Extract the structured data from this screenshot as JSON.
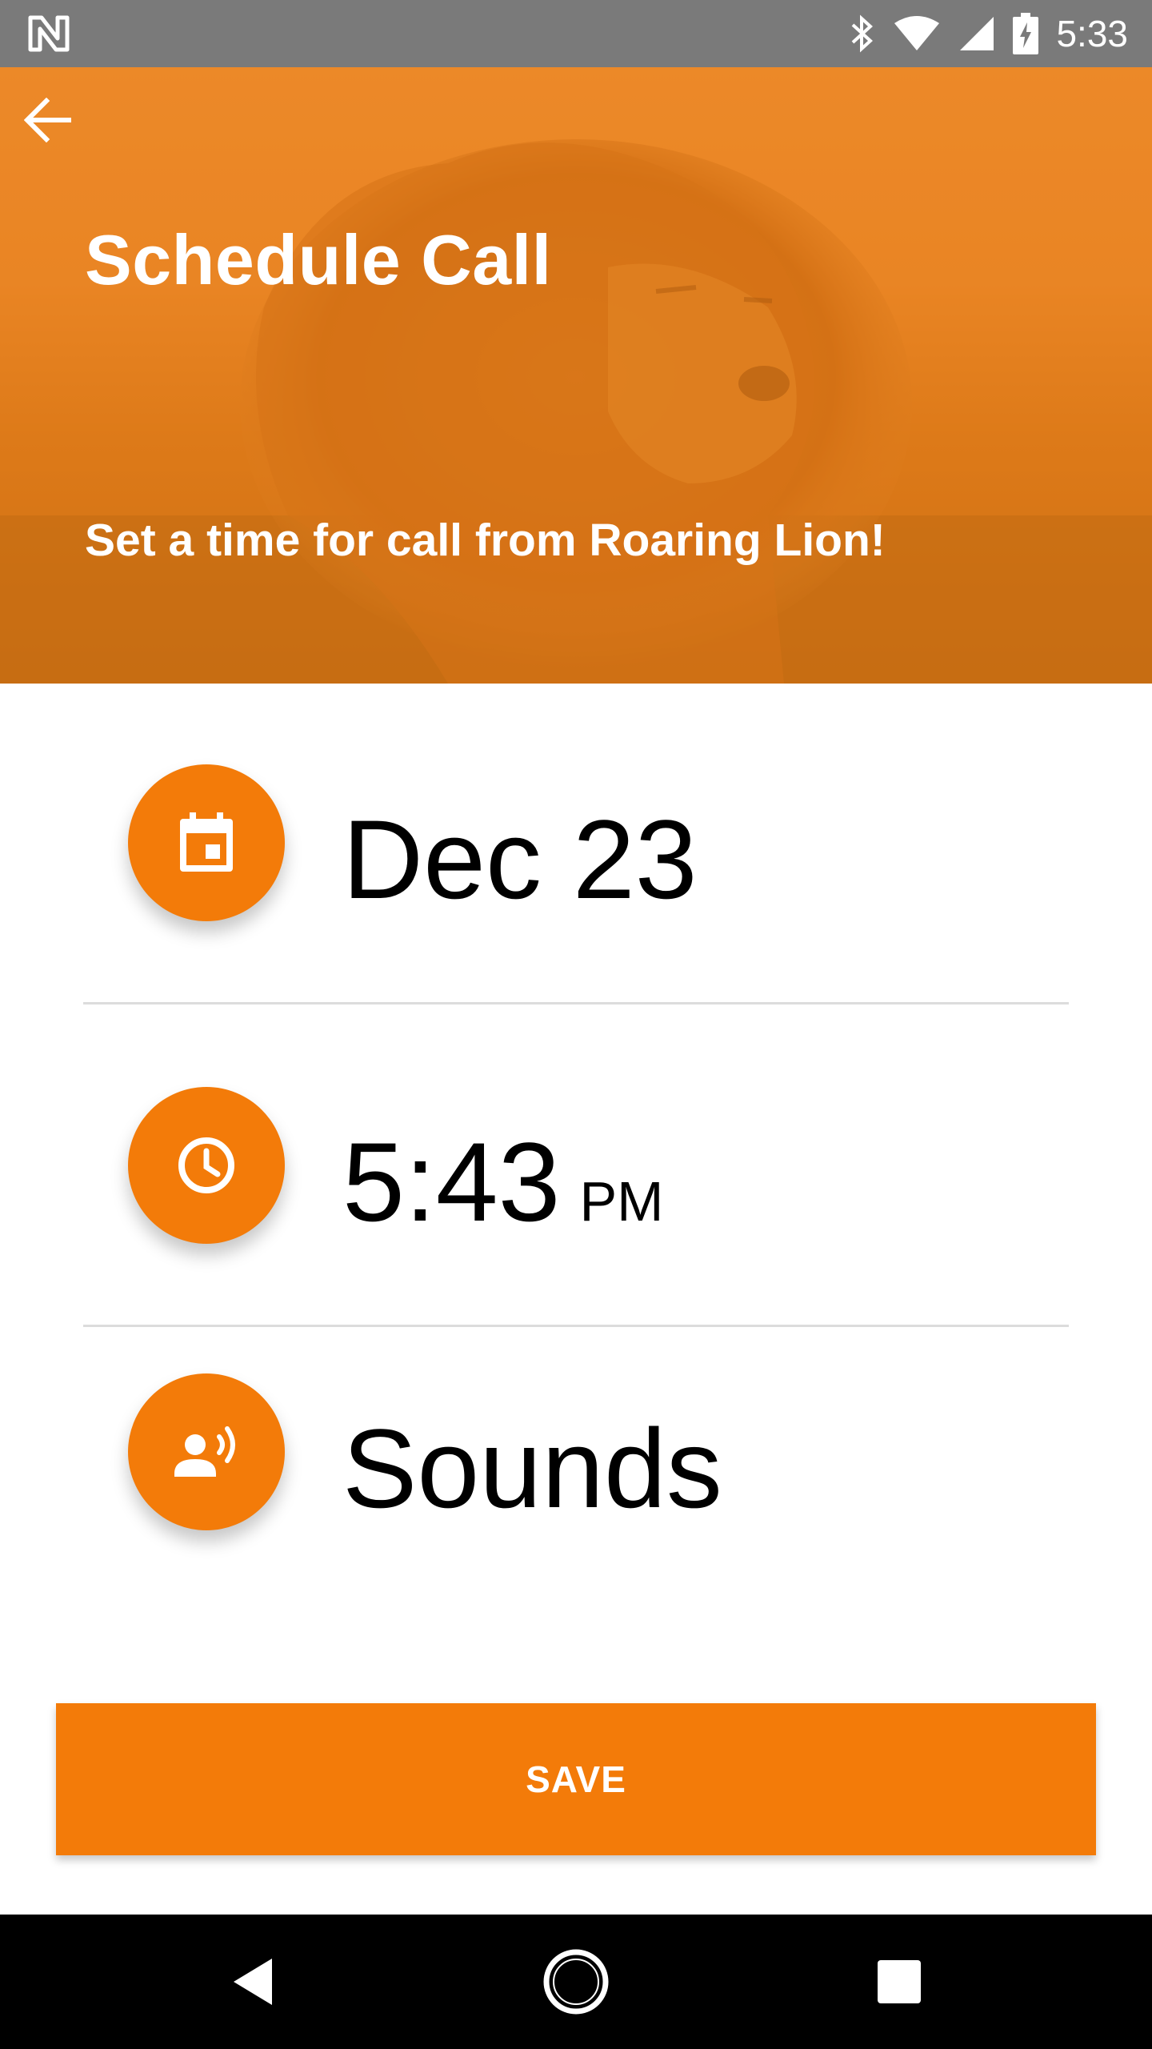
{
  "status_bar": {
    "time": "5:33",
    "icons": [
      "notification-n-icon",
      "bluetooth-icon",
      "wifi-icon",
      "signal-icon",
      "battery-charging-icon"
    ]
  },
  "header": {
    "back_icon": "arrow-back-icon",
    "title": "Schedule Call",
    "subtitle": "Set a time for call from Roaring Lion!",
    "overlay_color": "#f37b09",
    "background_image": "lion-photo"
  },
  "schedule": {
    "date": {
      "icon": "calendar-icon",
      "value": "Dec 23"
    },
    "time": {
      "icon": "clock-icon",
      "value": "5:43",
      "period": "PM"
    },
    "sounds": {
      "icon": "voice-person-icon",
      "value": "Sounds"
    }
  },
  "save_button": {
    "label": "SAVE"
  },
  "nav_bar": {
    "buttons": [
      "back-triangle-icon",
      "home-circle-icon",
      "recents-square-icon"
    ]
  },
  "colors": {
    "accent": "#f37b09",
    "status_bar": "#7a7a7a",
    "divider": "#dcdcdc"
  }
}
